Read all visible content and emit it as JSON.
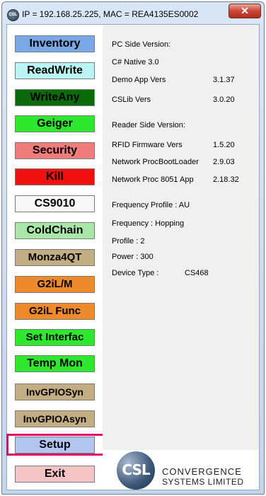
{
  "window": {
    "title": "IP = 192.168.25.225, MAC = REA4135ES0002",
    "app_icon_text": "CSL",
    "close_symbol": "✕"
  },
  "buttons": [
    {
      "label": "Inventory",
      "color": "#7aa7e6"
    },
    {
      "label": "ReadWrite",
      "color": "#b9f5f5"
    },
    {
      "label": "WriteAny",
      "color": "#0b6b0b"
    },
    {
      "label": "Geiger",
      "color": "#2ee82e"
    },
    {
      "label": "Security",
      "color": "#f07b7b"
    },
    {
      "label": "Kill",
      "color": "#ef1010"
    },
    {
      "label": "CS9010",
      "color": "#f8f8f8"
    },
    {
      "label": "ColdChain",
      "color": "#a9e7a9"
    },
    {
      "label": "Monza4QT",
      "color": "#c2ae82"
    },
    {
      "label": "G2iL/M",
      "color": "#ef8a2c"
    },
    {
      "label": "G2iL Func",
      "color": "#ef8a2c"
    },
    {
      "label": "Set Interfac",
      "color": "#2ee82e"
    },
    {
      "label": "Temp Mon",
      "color": "#2ee82e"
    },
    {
      "label": "InvGPIOSyn",
      "color": "#c2ae82"
    },
    {
      "label": "InvGPIOAsyn",
      "color": "#c2ae82"
    },
    {
      "label": "Setup",
      "color": "#b3c6f0"
    },
    {
      "label": "Exit",
      "color": "#f4c3c3"
    }
  ],
  "info": {
    "pc_side_title": "PC Side Version:",
    "csharp": "C# Native 3.0",
    "demo_label": "Demo App Vers",
    "demo_value": "3.1.37",
    "cslib_label": "CSLib Vers",
    "cslib_value": "3.0.20",
    "reader_side_title": "Reader Side Version:",
    "rfid_label": "RFID Firmware Vers",
    "rfid_value": "1.5.20",
    "netboot_label": "Network ProcBootLoader",
    "netboot_value": "2.9.03",
    "netproc_label": "Network Proc  8051 App",
    "netproc_value": "2.18.32",
    "freq_profile": "Frequency Profile : AU",
    "frequency": "Frequency : Hopping",
    "profile": "Profile : 2",
    "power": "Power : 300",
    "device_label": "Device Type :",
    "device_value": "CS468"
  },
  "logo": {
    "mark": "CSL",
    "line1": "CONVERGENCE",
    "line2": "SYSTEMS LIMITED"
  }
}
